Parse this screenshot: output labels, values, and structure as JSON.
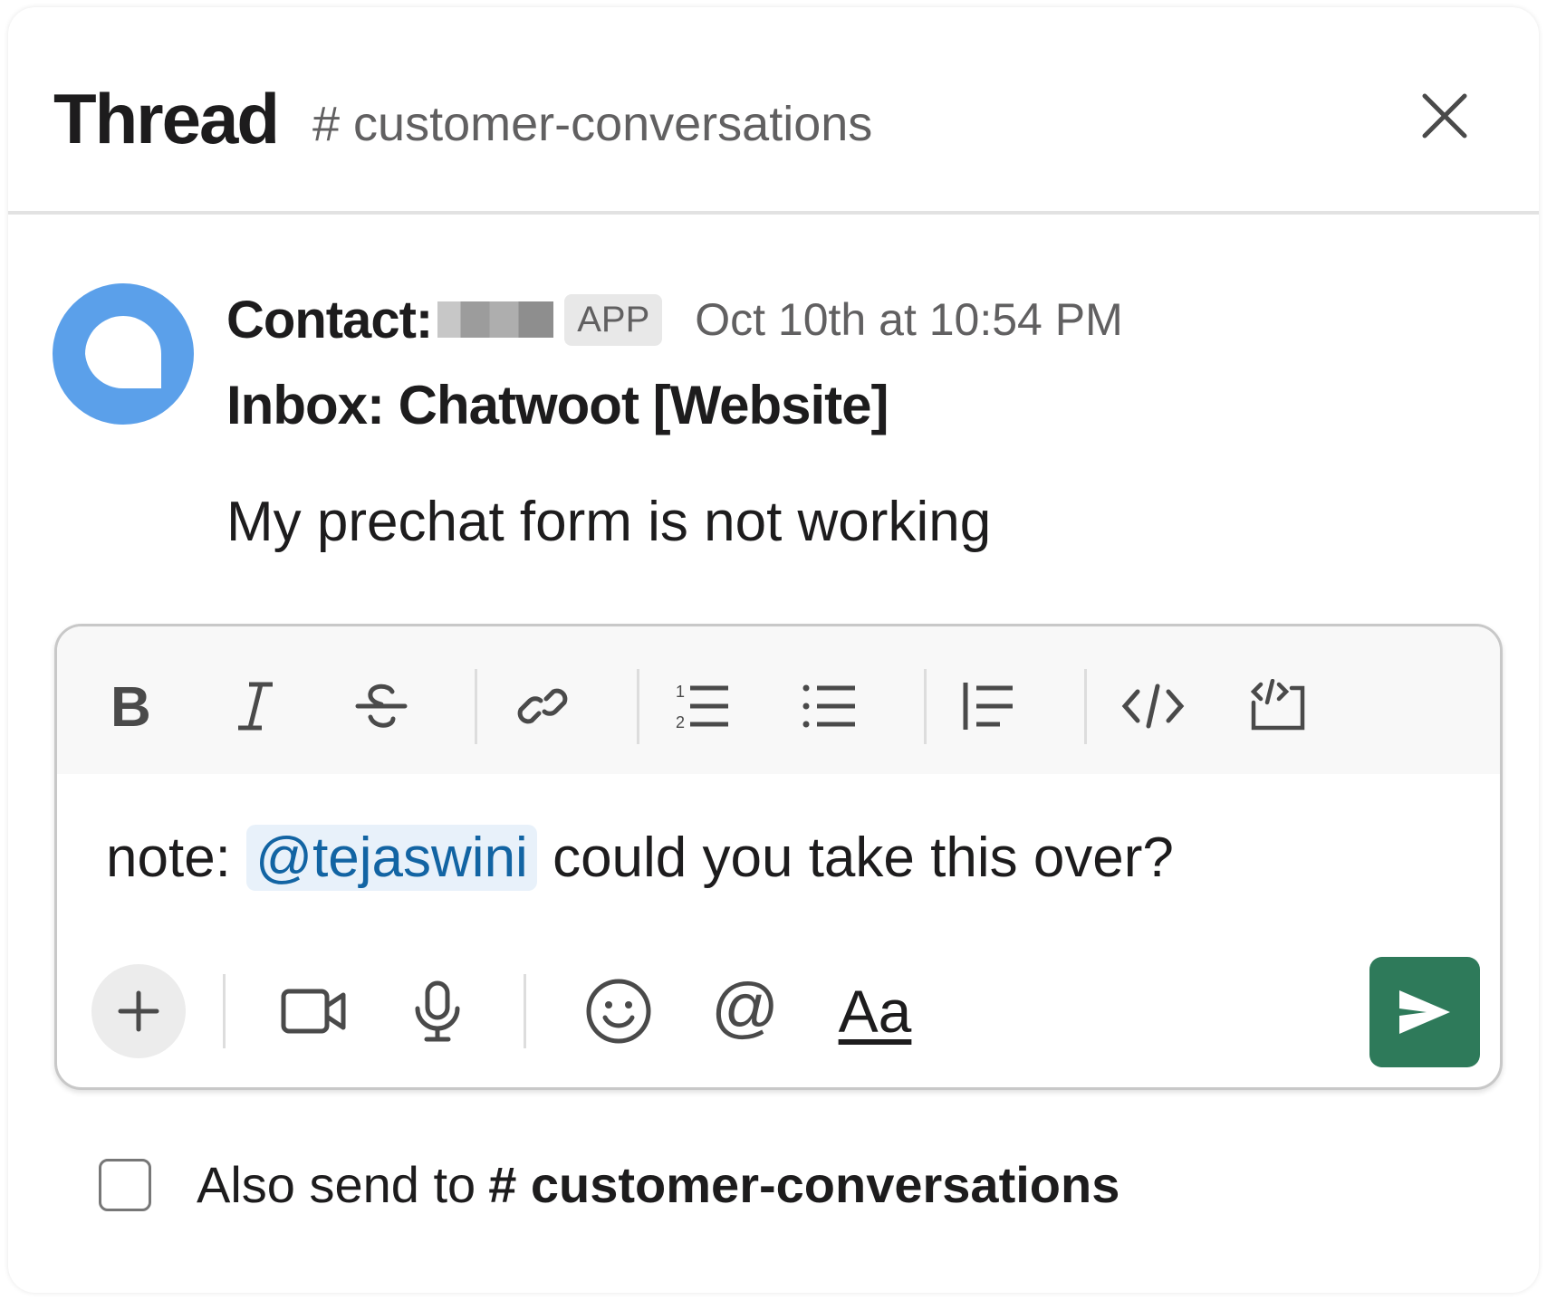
{
  "header": {
    "title": "Thread",
    "channel": "# customer-conversations",
    "close_icon": "close-icon"
  },
  "message": {
    "avatar_icon": "chatwoot-logo-icon",
    "avatar_color": "#5ba0ea",
    "contact_label": "Contact:",
    "contact_name_redacted": true,
    "app_badge": "APP",
    "timestamp": "Oct 10th at 10:54 PM",
    "inbox": "Inbox: Chatwoot [Website]",
    "body": "My prechat form is not working"
  },
  "composer": {
    "format_toolbar": [
      {
        "name": "bold",
        "icon": "bold-icon"
      },
      {
        "name": "italic",
        "icon": "italic-icon"
      },
      {
        "name": "strikethrough",
        "icon": "strikethrough-icon"
      },
      {
        "name": "link",
        "icon": "link-icon"
      },
      {
        "name": "ordered-list",
        "icon": "ordered-list-icon"
      },
      {
        "name": "bulleted-list",
        "icon": "bulleted-list-icon"
      },
      {
        "name": "blockquote",
        "icon": "blockquote-icon"
      },
      {
        "name": "code",
        "icon": "code-icon"
      },
      {
        "name": "code-block",
        "icon": "code-block-icon"
      }
    ],
    "text_prefix": "note: ",
    "mention": "@tejaswini",
    "text_suffix": " could you take this over?",
    "mention_color": "#1264a3",
    "mention_bg": "#e8f1fa",
    "bottom_toolbar": [
      {
        "name": "attach",
        "icon": "plus-icon"
      },
      {
        "name": "video",
        "icon": "video-icon"
      },
      {
        "name": "audio",
        "icon": "microphone-icon"
      },
      {
        "name": "emoji",
        "icon": "emoji-icon"
      },
      {
        "name": "mention",
        "icon": "at-icon"
      },
      {
        "name": "formatting",
        "label": "Aa"
      }
    ],
    "send_icon": "send-icon",
    "send_color": "#2e7a5a"
  },
  "also_send": {
    "checked": false,
    "label": "Also send to",
    "channel": "# customer-conversations"
  }
}
